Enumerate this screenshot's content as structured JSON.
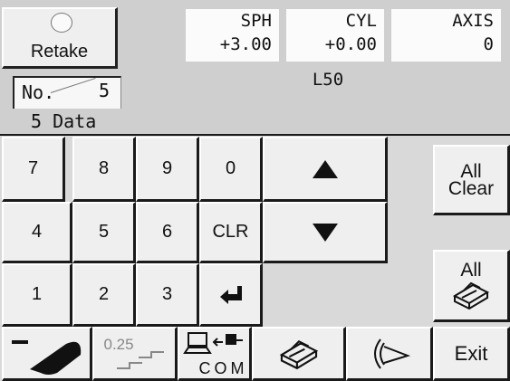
{
  "header": {
    "retake_label": "Retake",
    "no_label": "No.",
    "no_value": "5",
    "data_count": "5 Data",
    "sph": {
      "label": "SPH",
      "value": "+3.00"
    },
    "cyl": {
      "label": "CYL",
      "value": "+0.00"
    },
    "axis": {
      "label": "AXIS",
      "value": "0"
    },
    "mode": "L50"
  },
  "keypad": {
    "digits": [
      "7",
      "8",
      "9",
      "0",
      "4",
      "5",
      "6",
      "CLR",
      "1",
      "2",
      "3"
    ],
    "up_icon": "up-arrow-icon",
    "down_icon": "down-arrow-icon",
    "enter_icon": "enter-arrow-icon"
  },
  "side": {
    "all_clear_line1": "All",
    "all_clear_line2": "Clear",
    "all_print_line1": "All",
    "exit_label": "Exit"
  },
  "toolbar": {
    "step_label": "0.25",
    "com_label": "COM",
    "icons": [
      "minus-lens-icon",
      "step-icon",
      "computer-com-icon",
      "printer-icon",
      "eye-icon"
    ]
  }
}
